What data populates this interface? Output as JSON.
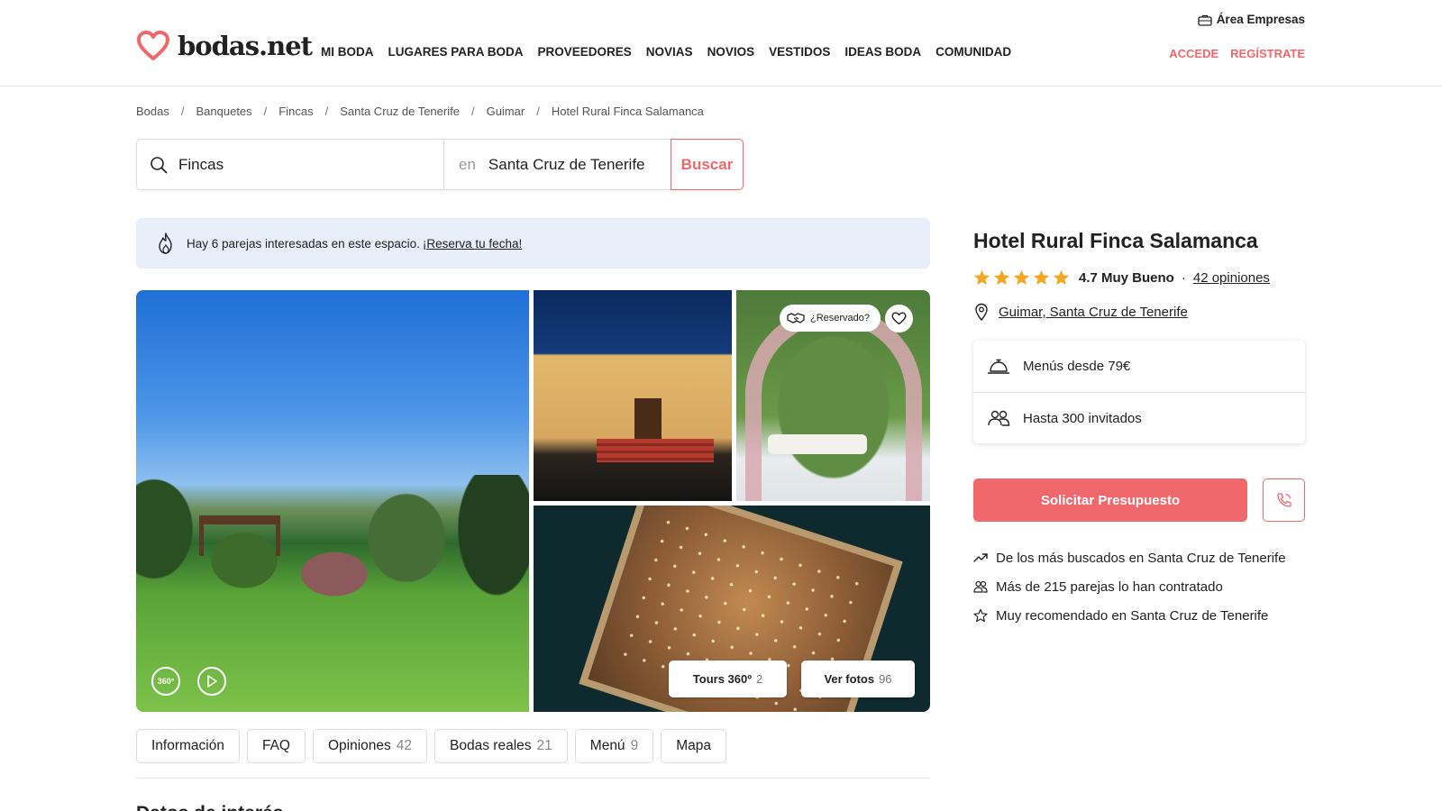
{
  "header": {
    "logo_text": "bodas.net",
    "empresas": "Área Empresas",
    "nav": [
      "MI BODA",
      "LUGARES PARA BODA",
      "PROVEEDORES",
      "NOVIAS",
      "NOVIOS",
      "VESTIDOS",
      "IDEAS BODA",
      "COMUNIDAD"
    ],
    "login": "ACCEDE",
    "register": "REGÍSTRATE",
    "brand_color": "#f0686b"
  },
  "breadcrumb": [
    "Bodas",
    "Banquetes",
    "Fincas",
    "Santa Cruz de Tenerife",
    "Guimar",
    "Hotel Rural Finca Salamanca"
  ],
  "search": {
    "query": "Fincas",
    "en": "en",
    "location": "Santa Cruz de Tenerife",
    "button": "Buscar"
  },
  "banner": {
    "text": "Hay 6 parejas interesadas en este espacio.",
    "link": "¡Reserva tu fecha!"
  },
  "gallery": {
    "reservado": "¿Reservado?",
    "tour_label": "360°",
    "tours_button": "Tours 360º",
    "tours_count": "2",
    "photos_button": "Ver fotos",
    "photos_count": "96"
  },
  "tabs": [
    {
      "label": "Información",
      "count": ""
    },
    {
      "label": "FAQ",
      "count": ""
    },
    {
      "label": "Opiniones",
      "count": "42"
    },
    {
      "label": "Bodas reales",
      "count": "21"
    },
    {
      "label": "Menú",
      "count": "9"
    },
    {
      "label": "Mapa",
      "count": ""
    }
  ],
  "section_peek": "Datos de interés",
  "venue": {
    "title": "Hotel Rural Finca Salamanca",
    "rating_score": "4.7 Muy Bueno",
    "rating_value": 4.7,
    "dot": "·",
    "reviews": "42 opiniones",
    "location": "Guimar, Santa Cruz de Tenerife",
    "menus": "Menús desde 79€",
    "guests": "Hasta 300 invitados",
    "cta": "Solicitar Presupuesto",
    "highlights": [
      "De los más buscados en Santa Cruz de Tenerife",
      "Más de 215 parejas lo han contratado",
      "Muy recomendado en Santa Cruz de Tenerife"
    ],
    "star_color": "#f5a623"
  }
}
